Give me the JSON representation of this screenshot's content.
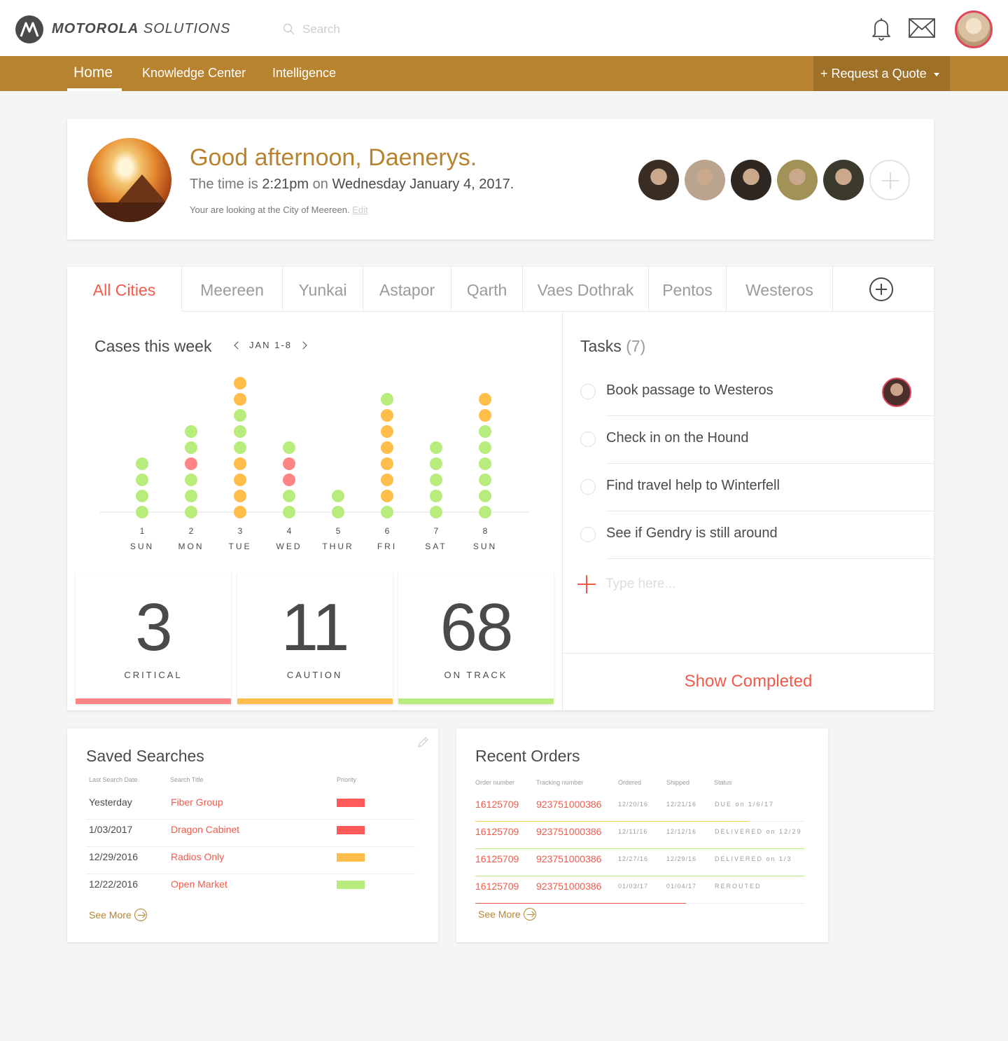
{
  "header": {
    "brand_bold": "MOTOROLA",
    "brand_light": "SOLUTIONS",
    "search_placeholder": "Search"
  },
  "nav": {
    "items": [
      "Home",
      "Knowledge Center",
      "Intelligence"
    ],
    "active": "Home",
    "quote_label": "+ Request a Quote"
  },
  "welcome": {
    "greeting": "Good afternoon, Daenerys.",
    "time_prefix": "The time is",
    "time": "2:21pm",
    "time_on": "on",
    "date": "Wednesday January 4, 2017.",
    "location_text": "Your are looking at the City of Meereen.",
    "edit_label": "Edit",
    "people_colors": [
      "#3a2d24",
      "#b9a48f",
      "#2f2722",
      "#a29258",
      "#3c3a2c"
    ]
  },
  "tabs": {
    "items": [
      "All Cities",
      "Meereen",
      "Yunkai",
      "Astapor",
      "Qarth",
      "Vaes Dothrak",
      "Pentos",
      "Westeros"
    ],
    "active": "All Cities"
  },
  "chart": {
    "title": "Cases this week",
    "range": "JAN 1-8"
  },
  "chart_data": {
    "type": "scatter",
    "title": "Cases this week",
    "categories": [
      "1",
      "2",
      "3",
      "4",
      "5",
      "6",
      "7",
      "8"
    ],
    "day_labels": [
      "SUN",
      "MON",
      "TUE",
      "WED",
      "THUR",
      "FRI",
      "SAT",
      "SUN"
    ],
    "series": [
      {
        "name": "CRITICAL",
        "color": "#ff8585",
        "values": [
          0,
          1,
          0,
          2,
          0,
          0,
          0,
          0
        ]
      },
      {
        "name": "CAUTION",
        "color": "#ffbd4a",
        "values": [
          0,
          0,
          4,
          0,
          0,
          6,
          0,
          2
        ]
      },
      {
        "name": "ON TRACK",
        "color": "#b8ec7c",
        "values": [
          4,
          4,
          5,
          3,
          2,
          1,
          5,
          6
        ]
      }
    ],
    "stacks": [
      [
        "g",
        "g",
        "g",
        "g"
      ],
      [
        "g",
        "g",
        "r",
        "g",
        "g",
        "g"
      ],
      [
        "o",
        "o",
        "g",
        "g",
        "g",
        "o",
        "o",
        "o",
        "o"
      ],
      [
        "g",
        "r",
        "r",
        "g",
        "g"
      ],
      [
        "g",
        "g"
      ],
      [
        "g",
        "o",
        "o",
        "o",
        "o",
        "o",
        "o",
        "g"
      ],
      [
        "g",
        "g",
        "g",
        "g",
        "g"
      ],
      [
        "o",
        "o",
        "g",
        "g",
        "g",
        "g",
        "g",
        "g"
      ]
    ]
  },
  "stats": [
    {
      "value": "3",
      "label": "CRITICAL",
      "color": "#ff8585"
    },
    {
      "value": "11",
      "label": "CAUTION",
      "color": "#ffbd4a"
    },
    {
      "value": "68",
      "label": "ON TRACK",
      "color": "#b8ec7c"
    }
  ],
  "tasks": {
    "title": "Tasks",
    "count": "(7)",
    "items": [
      "Book passage to Westeros",
      "Check in on the Hound",
      "Find travel help to Winterfell",
      "See if Gendry is still around"
    ],
    "input_placeholder": "Type here...",
    "show_completed": "Show Completed"
  },
  "saved_searches": {
    "title": "Saved Searches",
    "headers": [
      "Last Search Date",
      "Search Title",
      "Priority"
    ],
    "rows": [
      {
        "date": "Yesterday",
        "title": "Fiber Group",
        "priority_color": "#ff5a5a"
      },
      {
        "date": "1/03/2017",
        "title": "Dragon Cabinet",
        "priority_color": "#ff5a5a"
      },
      {
        "date": "12/29/2016",
        "title": "Radios Only",
        "priority_color": "#ffbd4a"
      },
      {
        "date": "12/22/2016",
        "title": "Open Market",
        "priority_color": "#b8ec7c"
      }
    ],
    "see_more": "See More"
  },
  "recent_orders": {
    "title": "Recent Orders",
    "headers": [
      "Order number",
      "Tracking number",
      "Ordered",
      "Shipped",
      "Status"
    ],
    "rows": [
      {
        "order": "16125709",
        "tracking": "923751000386",
        "ordered": "12/20/16",
        "shipped": "12/21/16",
        "status": "DUE on 1/6/17",
        "progress": 0.83,
        "color": "#f0d34a"
      },
      {
        "order": "16125709",
        "tracking": "923751000386",
        "ordered": "12/11/16",
        "shipped": "12/12/16",
        "status": "DELIVERED on 12/29",
        "progress": 1.0,
        "color": "#b8ec7c"
      },
      {
        "order": "16125709",
        "tracking": "923751000386",
        "ordered": "12/27/16",
        "shipped": "12/29/16",
        "status": "DELIVERED on 1/3",
        "progress": 1.0,
        "color": "#b8ec7c"
      },
      {
        "order": "16125709",
        "tracking": "923751000386",
        "ordered": "01/03/17",
        "shipped": "01/04/17",
        "status": "REROUTED",
        "progress": 0.64,
        "color": "#f25a4b"
      }
    ],
    "see_more": "See More"
  }
}
